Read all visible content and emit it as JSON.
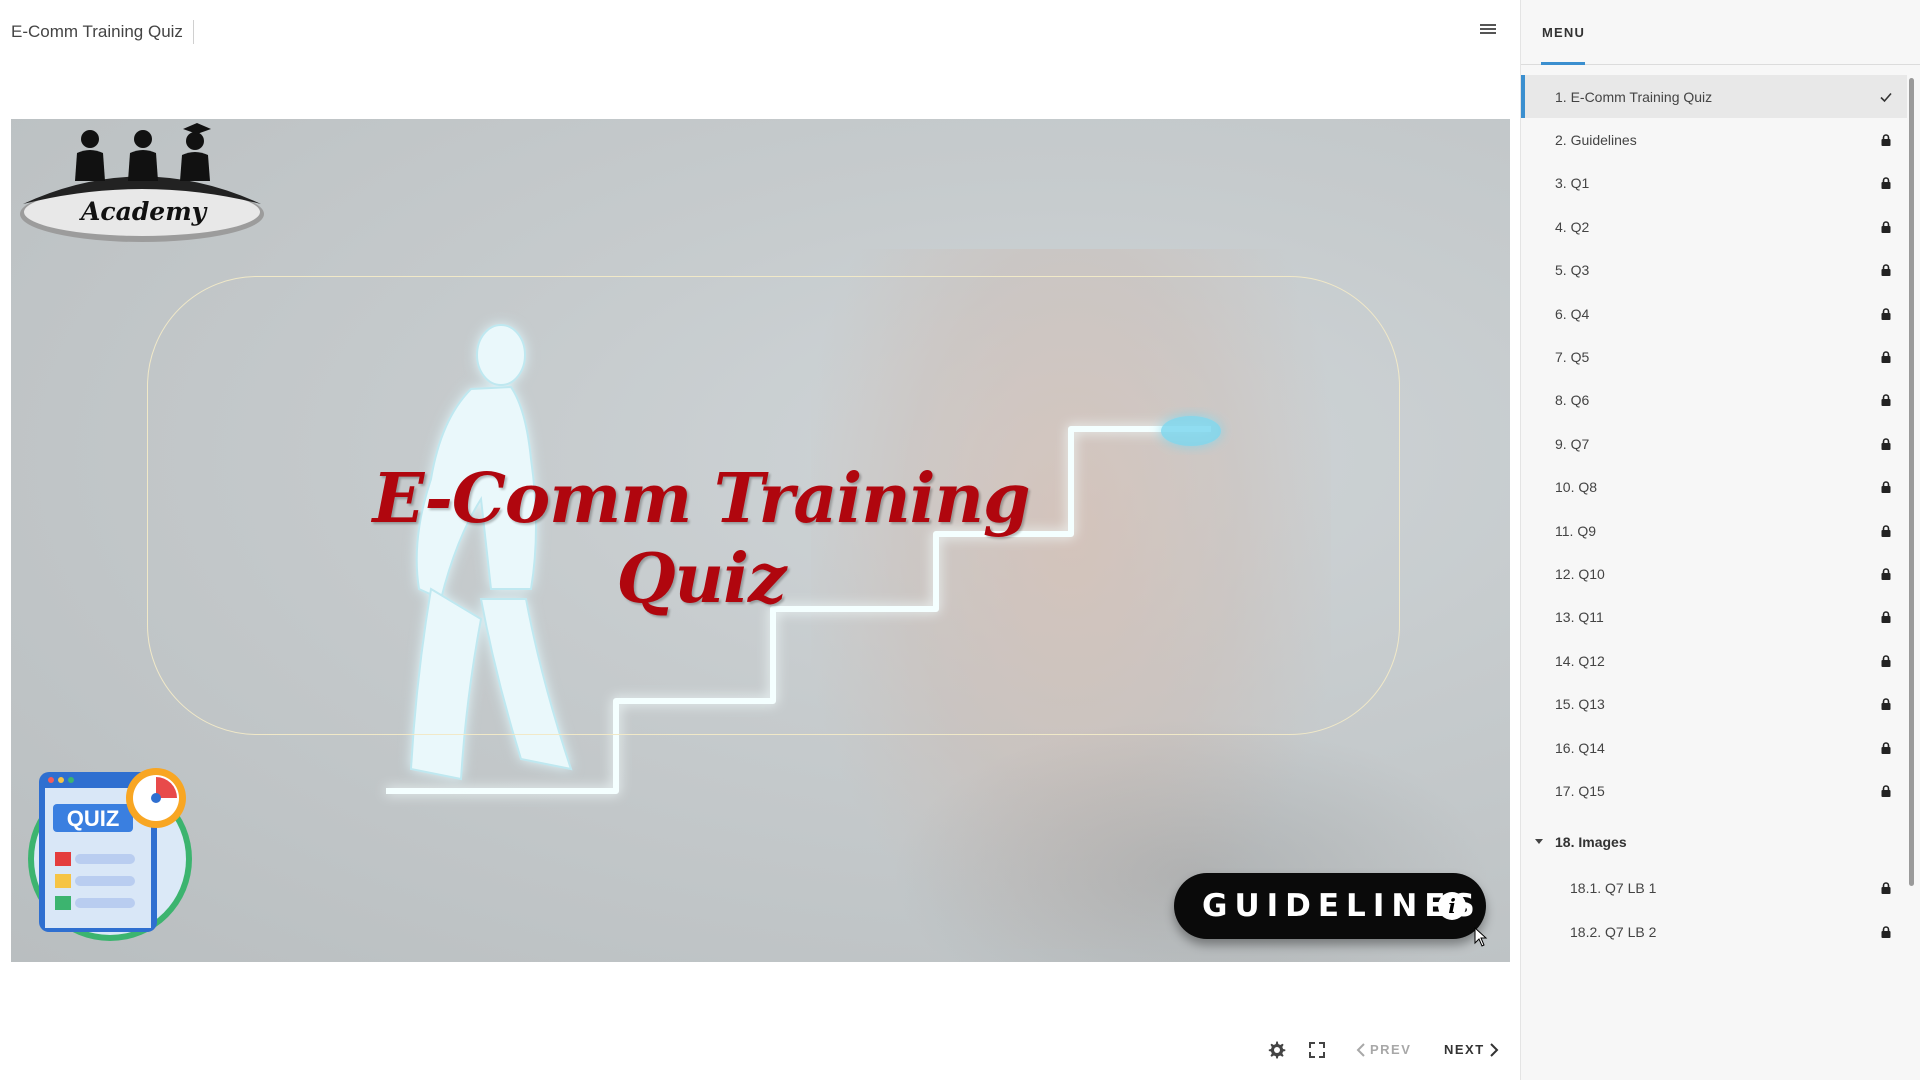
{
  "header": {
    "course_title": "E-Comm Training Quiz",
    "menu_icon": "hamburger-icon"
  },
  "slide": {
    "logo_text": "Academy",
    "title": "E-Comm Training Quiz",
    "badge_text": "QUIZ",
    "guidelines_label": "GUIDELINES",
    "info_glyph": "i",
    "title_color": "#b0060e"
  },
  "controls": {
    "settings_icon": "gear-icon",
    "fullscreen_icon": "fullscreen-icon",
    "prev_label": "PREV",
    "next_label": "NEXT"
  },
  "sidebar": {
    "title": "MENU",
    "accent_color": "#3b8fcf",
    "items": [
      {
        "label": "1. E-Comm Training Quiz",
        "status": "check"
      },
      {
        "label": "2. Guidelines",
        "status": "lock"
      },
      {
        "label": "3. Q1",
        "status": "lock"
      },
      {
        "label": "4. Q2",
        "status": "lock"
      },
      {
        "label": "5. Q3",
        "status": "lock"
      },
      {
        "label": "6. Q4",
        "status": "lock"
      },
      {
        "label": "7. Q5",
        "status": "lock"
      },
      {
        "label": "8. Q6",
        "status": "lock"
      },
      {
        "label": "9. Q7",
        "status": "lock"
      },
      {
        "label": "10. Q8",
        "status": "lock"
      },
      {
        "label": "11. Q9",
        "status": "lock"
      },
      {
        "label": "12. Q10",
        "status": "lock"
      },
      {
        "label": "13. Q11",
        "status": "lock"
      },
      {
        "label": "14. Q12",
        "status": "lock"
      },
      {
        "label": "15. Q13",
        "status": "lock"
      },
      {
        "label": "16. Q14",
        "status": "lock"
      },
      {
        "label": "17. Q15",
        "status": "lock"
      }
    ],
    "group": {
      "label": "18. Images",
      "items": [
        {
          "label": "18.1. Q7 LB 1",
          "status": "lock"
        },
        {
          "label": "18.2. Q7 LB 2",
          "status": "lock"
        }
      ]
    }
  }
}
